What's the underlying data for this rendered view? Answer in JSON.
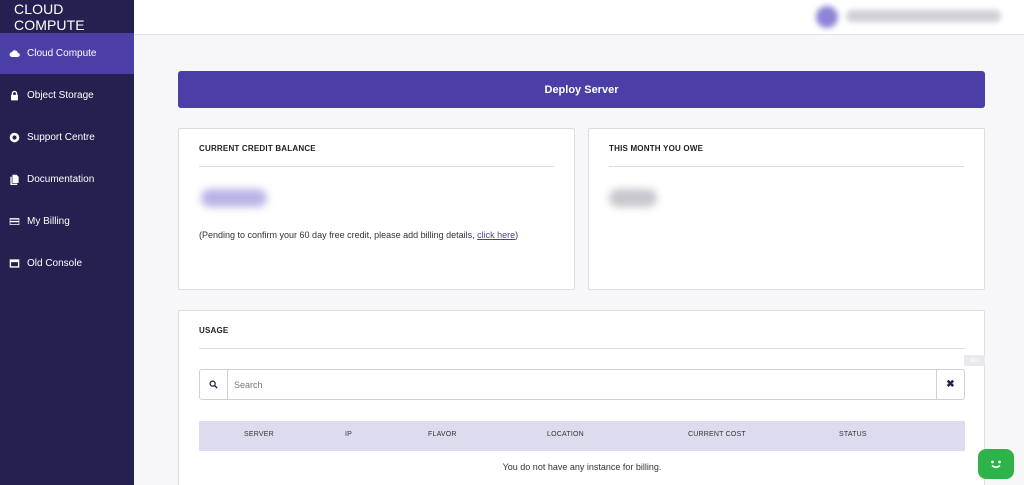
{
  "brand": "CLOUD COMPUTE",
  "sidebar": {
    "items": [
      {
        "label": "Cloud Compute",
        "icon": "cloud-icon",
        "active": true
      },
      {
        "label": "Object Storage",
        "icon": "lock-icon"
      },
      {
        "label": "Support Centre",
        "icon": "lifebuoy-icon"
      },
      {
        "label": "Documentation",
        "icon": "document-icon"
      },
      {
        "label": "My Billing",
        "icon": "credit-card-icon"
      },
      {
        "label": "Old Console",
        "icon": "window-icon"
      }
    ]
  },
  "deploy_button": "Deploy Server",
  "credit_card": {
    "title": "CURRENT CREDIT BALANCE",
    "pending_text": "(Pending to confirm your 60 day free credit, please add billing details, ",
    "link_text": "click here",
    "pending_suffix": ")"
  },
  "owe_card": {
    "title": "THIS MONTH YOU OWE"
  },
  "usage": {
    "title": "USAGE",
    "search_placeholder": "Search",
    "clear_label": "✖",
    "columns": [
      "SERVER",
      "IP",
      "FLAVOR",
      "LOCATION",
      "CURRENT COST",
      "STATUS"
    ],
    "empty_text": "You do not have any instance for billing."
  },
  "badge": "9ko",
  "colors": {
    "sidebar_bg": "#24204f",
    "accent": "#4a3fa7",
    "chat_green": "#2db34a"
  }
}
